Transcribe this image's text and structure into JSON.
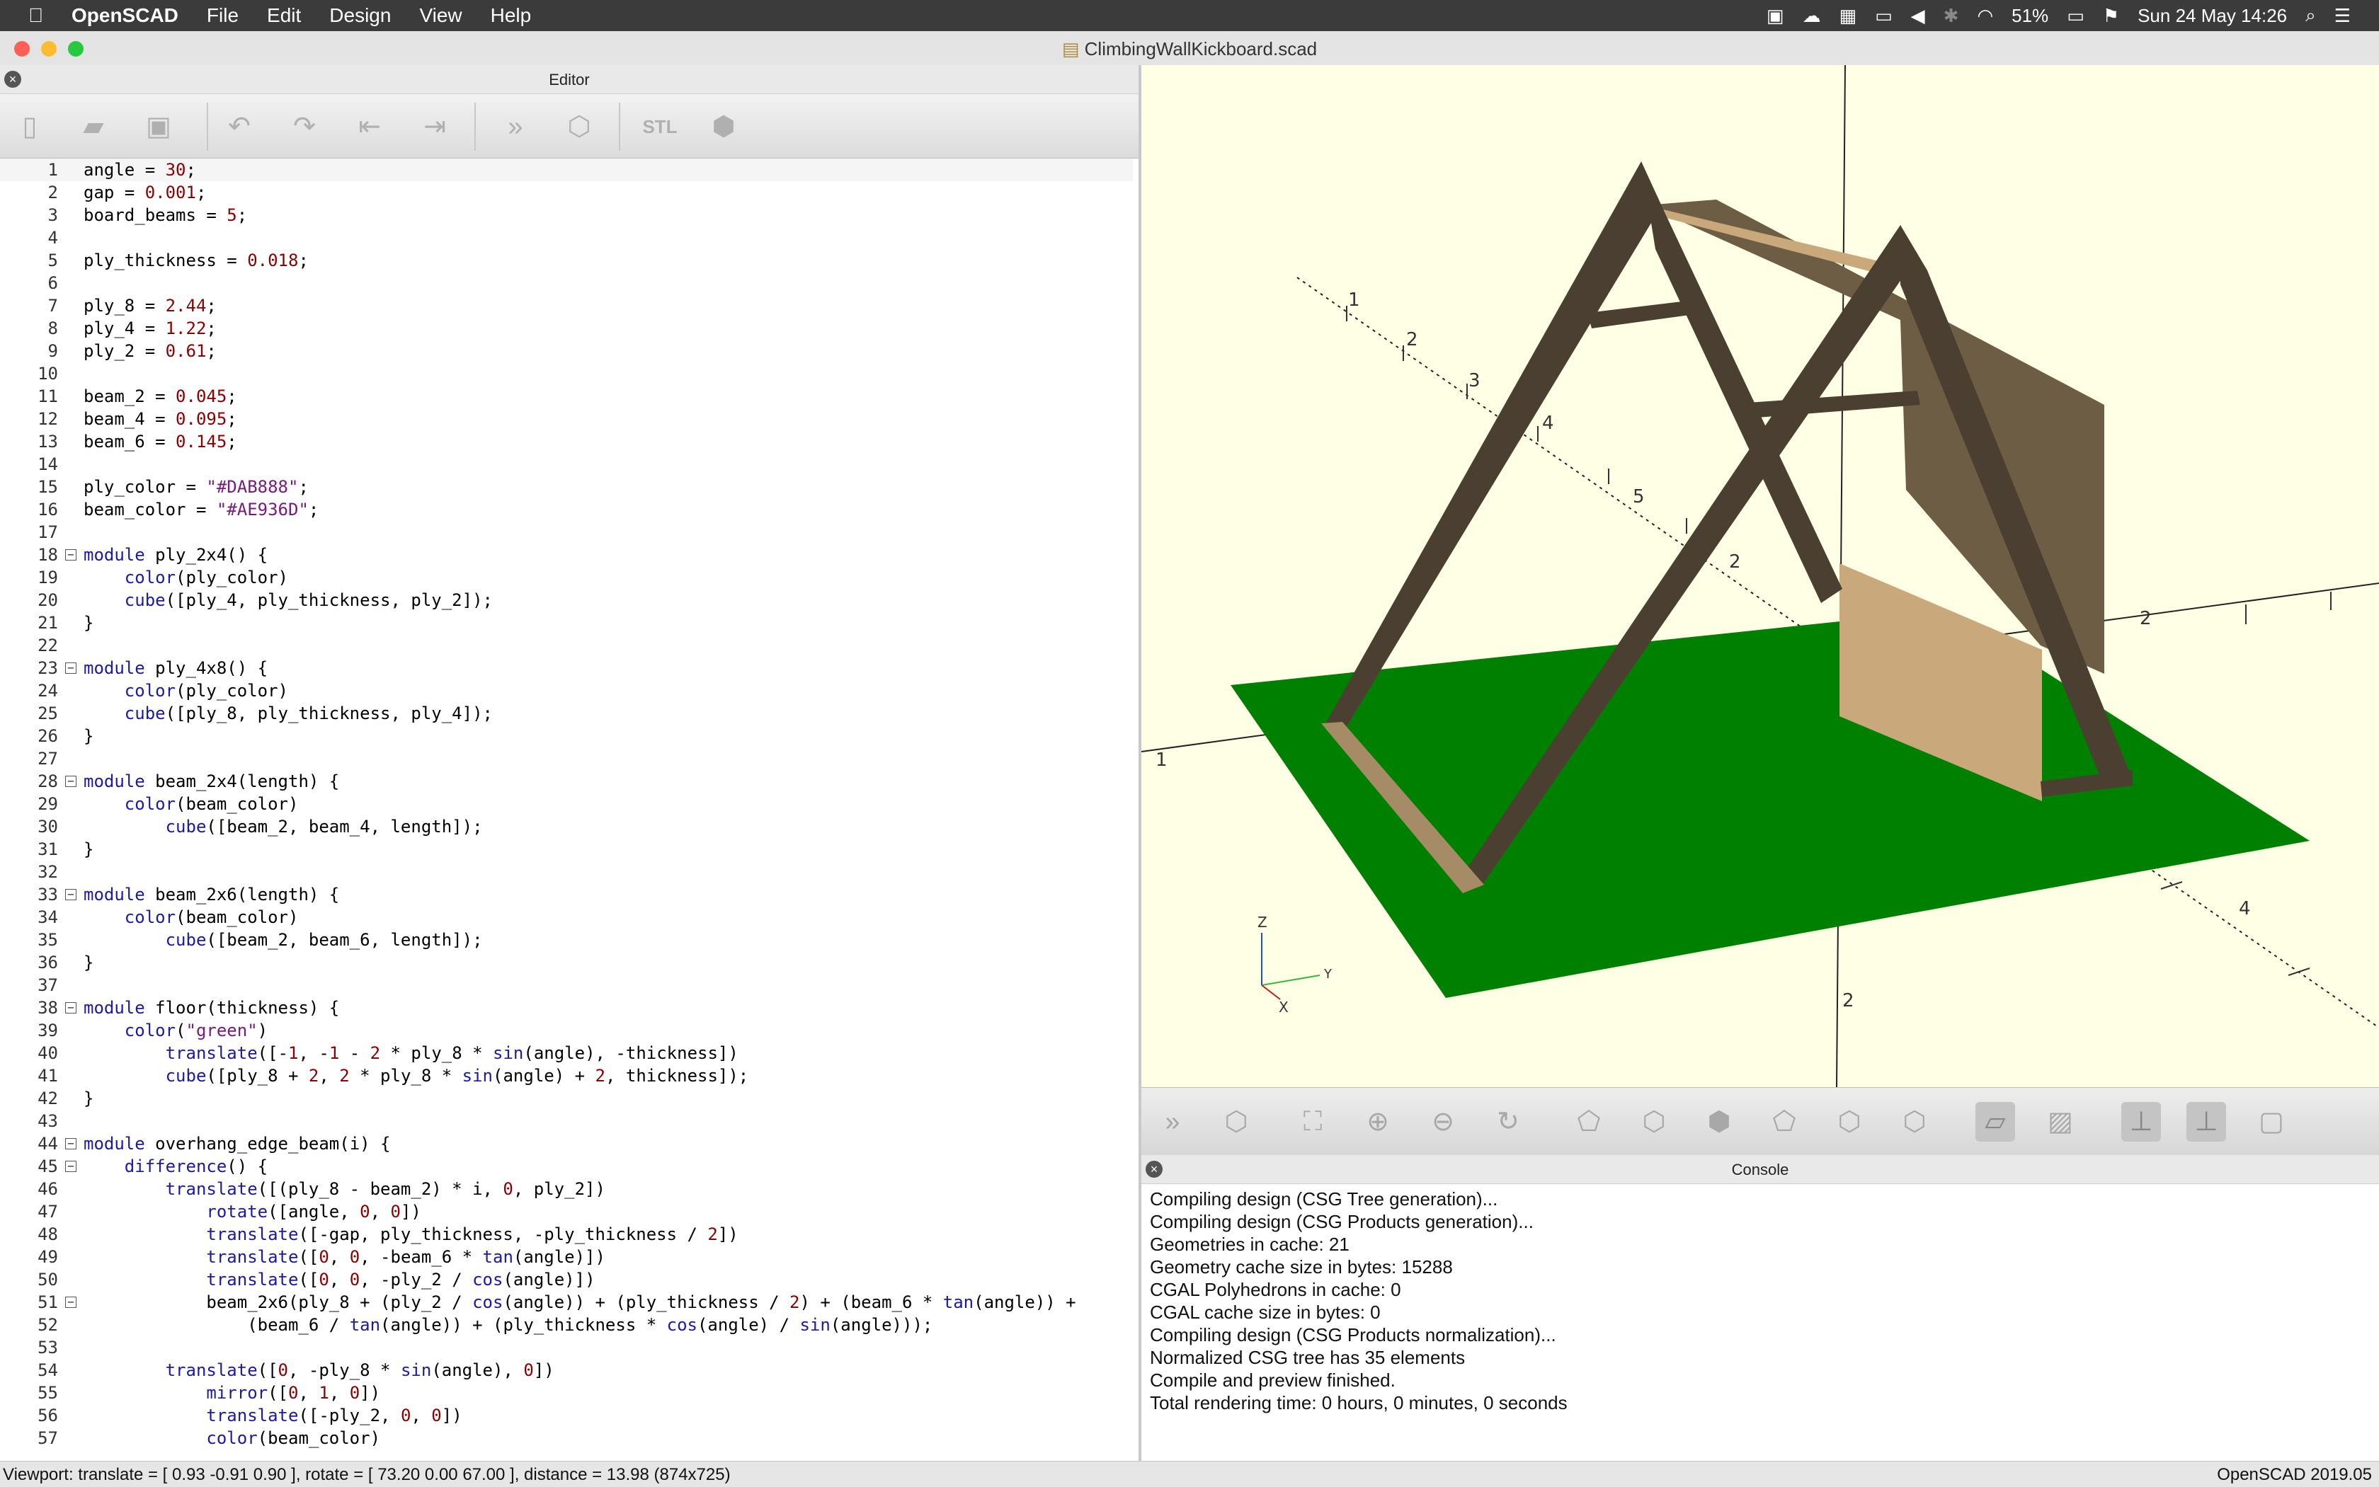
{
  "menubar": {
    "apple": "",
    "app_name": "OpenSCAD",
    "items": [
      "File",
      "Edit",
      "Design",
      "View",
      "Help"
    ],
    "battery": "51%",
    "datetime": "Sun 24 May  14:26"
  },
  "window": {
    "title": "ClimbingWallKickboard.scad"
  },
  "editor": {
    "title": "Editor",
    "toolbar": [
      "new-file-icon",
      "open-file-icon",
      "save-icon",
      "undo-icon",
      "redo-icon",
      "unindent-icon",
      "indent-icon",
      "preview-icon",
      "render-icon",
      "export-stl-icon",
      "export-icon"
    ],
    "export_stl_label": "STL",
    "lines": [
      {
        "n": "1",
        "t": "angle = 30;"
      },
      {
        "n": "2",
        "t": "gap = 0.001;"
      },
      {
        "n": "3",
        "t": "board_beams = 5;"
      },
      {
        "n": "4",
        "t": ""
      },
      {
        "n": "5",
        "t": "ply_thickness = 0.018;"
      },
      {
        "n": "6",
        "t": ""
      },
      {
        "n": "7",
        "t": "ply_8 = 2.44;"
      },
      {
        "n": "8",
        "t": "ply_4 = 1.22;"
      },
      {
        "n": "9",
        "t": "ply_2 = 0.61;"
      },
      {
        "n": "10",
        "t": ""
      },
      {
        "n": "11",
        "t": "beam_2 = 0.045;"
      },
      {
        "n": "12",
        "t": "beam_4 = 0.095;"
      },
      {
        "n": "13",
        "t": "beam_6 = 0.145;"
      },
      {
        "n": "14",
        "t": ""
      },
      {
        "n": "15",
        "t": "ply_color = \"#DAB888\";"
      },
      {
        "n": "16",
        "t": "beam_color = \"#AE936D\";"
      },
      {
        "n": "17",
        "t": ""
      },
      {
        "n": "18",
        "t": "module ply_2x4() {",
        "fold": true
      },
      {
        "n": "19",
        "t": "    color(ply_color)"
      },
      {
        "n": "20",
        "t": "    cube([ply_4, ply_thickness, ply_2]);"
      },
      {
        "n": "21",
        "t": "}"
      },
      {
        "n": "22",
        "t": ""
      },
      {
        "n": "23",
        "t": "module ply_4x8() {",
        "fold": true
      },
      {
        "n": "24",
        "t": "    color(ply_color)"
      },
      {
        "n": "25",
        "t": "    cube([ply_8, ply_thickness, ply_4]);"
      },
      {
        "n": "26",
        "t": "}"
      },
      {
        "n": "27",
        "t": ""
      },
      {
        "n": "28",
        "t": "module beam_2x4(length) {",
        "fold": true
      },
      {
        "n": "29",
        "t": "    color(beam_color)"
      },
      {
        "n": "30",
        "t": "        cube([beam_2, beam_4, length]);"
      },
      {
        "n": "31",
        "t": "}"
      },
      {
        "n": "32",
        "t": ""
      },
      {
        "n": "33",
        "t": "module beam_2x6(length) {",
        "fold": true
      },
      {
        "n": "34",
        "t": "    color(beam_color)"
      },
      {
        "n": "35",
        "t": "        cube([beam_2, beam_6, length]);"
      },
      {
        "n": "36",
        "t": "}"
      },
      {
        "n": "37",
        "t": ""
      },
      {
        "n": "38",
        "t": "module floor(thickness) {",
        "fold": true
      },
      {
        "n": "39",
        "t": "    color(\"green\")"
      },
      {
        "n": "40",
        "t": "        translate([-1, -1 - 2 * ply_8 * sin(angle), -thickness])"
      },
      {
        "n": "41",
        "t": "        cube([ply_8 + 2, 2 * ply_8 * sin(angle) + 2, thickness]);"
      },
      {
        "n": "42",
        "t": "}"
      },
      {
        "n": "43",
        "t": ""
      },
      {
        "n": "44",
        "t": "module overhang_edge_beam(i) {",
        "fold": true
      },
      {
        "n": "45",
        "t": "    difference() {",
        "fold": true
      },
      {
        "n": "46",
        "t": "        translate([(ply_8 - beam_2) * i, 0, ply_2])"
      },
      {
        "n": "47",
        "t": "            rotate([angle, 0, 0])"
      },
      {
        "n": "48",
        "t": "            translate([-gap, ply_thickness, -ply_thickness / 2])"
      },
      {
        "n": "49",
        "t": "            translate([0, 0, -beam_6 * tan(angle)])"
      },
      {
        "n": "50",
        "t": "            translate([0, 0, -ply_2 / cos(angle)])"
      },
      {
        "n": "51",
        "t": "            beam_2x6(ply_8 + (ply_2 / cos(angle)) + (ply_thickness / 2) + (beam_6 * tan(angle)) +",
        "fold": true
      },
      {
        "n": "52",
        "t": "                (beam_6 / tan(angle)) + (ply_thickness * cos(angle) / sin(angle)));"
      },
      {
        "n": "53",
        "t": ""
      },
      {
        "n": "54",
        "t": "        translate([0, -ply_8 * sin(angle), 0])"
      },
      {
        "n": "55",
        "t": "            mirror([0, 1, 0])"
      },
      {
        "n": "56",
        "t": "            translate([-ply_2, 0, 0])"
      },
      {
        "n": "57",
        "t": "            color(beam_color)"
      }
    ]
  },
  "viewport": {
    "axis_labels": {
      "z": "Z",
      "y": "Y",
      "x": "X"
    },
    "ruler_numbers": [
      "1",
      "2",
      "3",
      "4",
      "5",
      "2",
      "2",
      "4",
      "2",
      "1"
    ],
    "colors": {
      "background": "#FFFFE5",
      "floor": "#008000",
      "beam": "#4A3F30",
      "ply": "#C9A97C",
      "ply_shadow": "#6E5D45"
    }
  },
  "view_toolbar": [
    "preview-icon",
    "render-icon",
    "view-all-icon",
    "zoom-in-icon",
    "zoom-out-icon",
    "reset-view-icon",
    "right-view-icon",
    "top-view-icon",
    "bottom-view-icon",
    "left-view-icon",
    "front-view-icon",
    "back-view-icon",
    "perspective-icon",
    "orthogonal-icon",
    "show-axes-icon",
    "show-scale-markers-icon",
    "show-edges-icon"
  ],
  "console": {
    "title": "Console",
    "lines": [
      "Compiling design (CSG Tree generation)...",
      "Compiling design (CSG Products generation)...",
      "Geometries in cache: 21",
      "Geometry cache size in bytes: 15288",
      "CGAL Polyhedrons in cache: 0",
      "CGAL cache size in bytes: 0",
      "Compiling design (CSG Products normalization)...",
      "Normalized CSG tree has 35 elements",
      "Compile and preview finished.",
      "Total rendering time: 0 hours, 0 minutes, 0 seconds"
    ]
  },
  "statusbar": {
    "viewport_info": "Viewport: translate = [ 0.93 -0.91 0.90 ], rotate = [ 73.20 0.00 67.00 ], distance = 13.98 (874x725)",
    "version": "OpenSCAD 2019.05"
  }
}
